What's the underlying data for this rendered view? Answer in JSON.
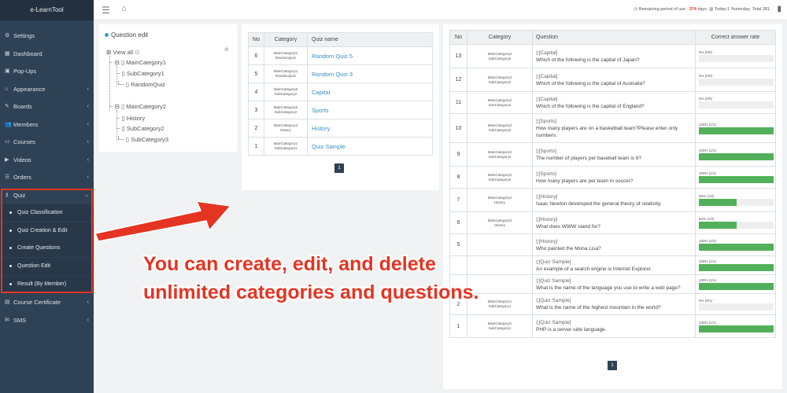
{
  "sidebar": {
    "brand": "e-LearnTool",
    "items": [
      {
        "label": "Settings",
        "icon": "gear-icon",
        "glyph": "⚙",
        "chev": ""
      },
      {
        "label": "Dashboard",
        "icon": "dashboard-icon",
        "glyph": "▦",
        "chev": ""
      },
      {
        "label": "Pop-Ups",
        "icon": "popup-icon",
        "glyph": "▣",
        "chev": ""
      },
      {
        "label": "Appearance",
        "icon": "home-icon",
        "glyph": "⌂",
        "chev": "‹"
      },
      {
        "label": "Boards",
        "icon": "pencil-icon",
        "glyph": "✎",
        "chev": "‹"
      },
      {
        "label": "Members",
        "icon": "users-icon",
        "glyph": "👥",
        "chev": "‹"
      },
      {
        "label": "Courses",
        "icon": "folder-icon",
        "glyph": "▭",
        "chev": "‹"
      },
      {
        "label": "Videos",
        "icon": "video-icon",
        "glyph": "▶",
        "chev": "‹"
      },
      {
        "label": "Orders",
        "icon": "list-icon",
        "glyph": "☰",
        "chev": "‹"
      },
      {
        "label": "Quiz",
        "icon": "key-icon",
        "glyph": "⚷",
        "chev": "⌄"
      }
    ],
    "quiz_sub": [
      "Quiz Classification",
      "Quiz Creation & Edit",
      "Create Questions",
      "Question Edit",
      "Result (By Member)"
    ],
    "after": [
      {
        "label": "Course Certificate",
        "icon": "certificate-icon",
        "glyph": "▤",
        "chev": "‹"
      },
      {
        "label": "SMS",
        "icon": "sms-icon",
        "glyph": "✉",
        "chev": "‹"
      }
    ]
  },
  "topbar": {
    "remaining_prefix": "Remaining period of use :",
    "remaining_days": "374",
    "remaining_suffix": "days",
    "stats": "Today:1 Yesterday: Total 381"
  },
  "tree": {
    "title": "Question edit",
    "view_all": "View all",
    "nodes": [
      "MainCategory1",
      "SubCategory1",
      "RandomQuiz",
      "MainCategory2",
      "History",
      "SubCategory2",
      "SubCategory3"
    ]
  },
  "quiz_table": {
    "headers": [
      "No",
      "Category",
      "Quiz name"
    ],
    "rows": [
      {
        "no": "6",
        "cat1": "MainCategory1",
        "cat2": "RandomQuiz",
        "name": "Random Quiz 5"
      },
      {
        "no": "5",
        "cat1": "MainCategory1",
        "cat2": "RandomQuiz",
        "name": "Random Quiz 3"
      },
      {
        "no": "4",
        "cat1": "MainCategory2",
        "cat2": "SubCategory2",
        "name": "Capital"
      },
      {
        "no": "3",
        "cat1": "MainCategory2",
        "cat2": "SubCategory2",
        "name": "Sports"
      },
      {
        "no": "2",
        "cat1": "MainCategory2",
        "cat2": "History",
        "name": "History"
      },
      {
        "no": "1",
        "cat1": "MainCategory1",
        "cat2": "SubCategory1",
        "name": "Quiz Sample"
      }
    ],
    "page": "1"
  },
  "answer_table": {
    "headers": [
      "No",
      "Category",
      "Question",
      "Correct answer rate"
    ],
    "rows": [
      {
        "no": "13",
        "cat1": "MainCategory2",
        "cat2": "SubCategory2",
        "qcat": "[Capital]",
        "q": "Which of the following is the capital of Japan?",
        "rate": "0% (0/0)",
        "pct": 0
      },
      {
        "no": "12",
        "cat1": "MainCategory2",
        "cat2": "SubCategory2",
        "qcat": "[Capital]",
        "q": "Which of the following is the capital of Australia?",
        "rate": "0% (0/0)",
        "pct": 0
      },
      {
        "no": "11",
        "cat1": "MainCategory2",
        "cat2": "SubCategory2",
        "qcat": "[Capital]",
        "q": "Which of the following is the capital of England?",
        "rate": "0% (0/0)",
        "pct": 0
      },
      {
        "no": "10",
        "cat1": "MainCategory2",
        "cat2": "SubCategory2",
        "qcat": "[Sports]",
        "q": "How many players are on a basketball team?Please enter only numbers.",
        "rate": "100% (1/1)",
        "pct": 100
      },
      {
        "no": "9",
        "cat1": "MainCategory2",
        "cat2": "SubCategory2",
        "qcat": "[Sports]",
        "q": "The number of players per baseball team is 6?",
        "rate": "100% (1/1)",
        "pct": 100
      },
      {
        "no": "8",
        "cat1": "MainCategory2",
        "cat2": "SubCategory2",
        "qcat": "[Sports]",
        "q": "How many players are per team in soccer?",
        "rate": "100% (1/1)",
        "pct": 100
      },
      {
        "no": "7",
        "cat1": "MainCategory2",
        "cat2": "History",
        "qcat": "[History]",
        "q": "Isaac Newton developed the general theory of relativity.",
        "rate": "50% (1/2)",
        "pct": 50
      },
      {
        "no": "6",
        "cat1": "MainCategory2",
        "cat2": "History",
        "qcat": "[History]",
        "q": "What does WWW stand for?",
        "rate": "50% (1/2)",
        "pct": 50
      },
      {
        "no": "5",
        "cat1": "",
        "cat2": "",
        "qcat": "[History]",
        "q": "Who painted the Mona Lisa?",
        "rate": "100% (2/2)",
        "pct": 100
      },
      {
        "no": "",
        "cat1": "",
        "cat2": "",
        "qcat": "[Quiz Sample]",
        "q": "An example of a search engine is Internet Explorer.",
        "rate": "100% (1/1)",
        "pct": 100
      },
      {
        "no": "",
        "cat1": "",
        "cat2": "",
        "qcat": "[Quiz Sample]",
        "q": "What is the name of the language you use to write a web page?",
        "rate": "100% (1/1)",
        "pct": 100
      },
      {
        "no": "2",
        "cat1": "MainCategory1",
        "cat2": "SubCategory1",
        "qcat": "[Quiz Sample]",
        "q": "What is the name of the highest mountain in the world?",
        "rate": "0% (0/1)",
        "pct": 0
      },
      {
        "no": "1",
        "cat1": "MainCategory1",
        "cat2": "SubCategory1",
        "qcat": "[Quiz Sample]",
        "q": "PHP is a server-side language.",
        "rate": "100% (1/1)",
        "pct": 100
      }
    ],
    "page": "1"
  },
  "callout": {
    "line1": "You can create, edit, and delete",
    "line2": "unlimited categories and questions."
  },
  "colors": {
    "callout": "#e53422",
    "bar": "#52b05a",
    "sidebar": "#2f4155"
  }
}
